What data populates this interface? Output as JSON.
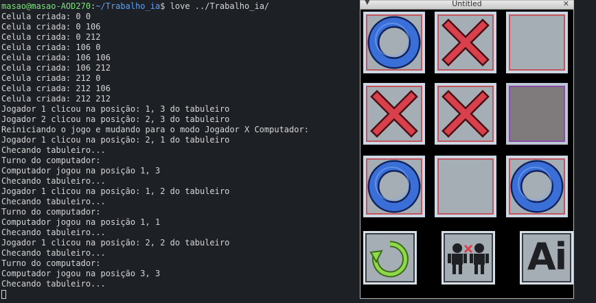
{
  "terminal": {
    "prompt": {
      "user_host": "masao@masao-AOD270",
      "separator": ":",
      "path": "~/Trabalho_ia",
      "symbol": "$",
      "command": " love ../Trabalho_ia/"
    },
    "lines": [
      "Celula criada: 0 0",
      "Celula criada: 0 106",
      "Celula criada: 0 212",
      "Celula criada: 106 0",
      "Celula criada: 106 106",
      "Celula criada: 106 212",
      "Celula criada: 212 0",
      "Celula criada: 212 106",
      "Celula criada: 212 212",
      "Jogador 1 clicou na posição: 1, 3 do tabuleiro",
      "Jogador 2 clicou na posição: 2, 3 do tabuleiro",
      "Reiniciando o jogo e mudando para o modo Jogador X Computador:",
      "Jogador 1 clicou na posição: 2, 1 do tabuleiro",
      "Checando tabuleiro...",
      "Turno do computador:",
      "Computador jogou na posição 1, 3",
      "Checando tabuleiro...",
      "Jogador 1 clicou na posição: 1, 2 do tabuleiro",
      "Checando tabuleiro...",
      "Turno do computador:",
      "Computador jogou na posição 1, 1",
      "Checando tabuleiro...",
      "Jogador 1 clicou na posição: 2, 2 do tabuleiro",
      "Checando tabuleiro...",
      "Turno do computador:",
      "Computador jogou na posição 3, 3",
      "Checando tabuleiro..."
    ]
  },
  "game_window": {
    "title": "Untitled",
    "menu_icon": "chevron-down-icon",
    "close_icon": "close-icon",
    "board": [
      [
        "O",
        "X",
        ""
      ],
      [
        "X",
        "X",
        ""
      ],
      [
        "O",
        "",
        "O"
      ]
    ],
    "highlighted_cell": "1,2",
    "controls": {
      "restart_icon": "restart-icon",
      "pvp_icon": "player-vs-player-icon",
      "ai_label": "Ai"
    }
  },
  "colors": {
    "terminal_bg": "#1d2025",
    "terminal_text": "#d6d6d6",
    "prompt_user": "#7fe07f",
    "prompt_path": "#5aa0ff",
    "o_mark": "#3a6fd8",
    "x_mark": "#d8404c",
    "cell_bg": "#a4aeb4",
    "restart_arrow": "#8ed84a"
  }
}
